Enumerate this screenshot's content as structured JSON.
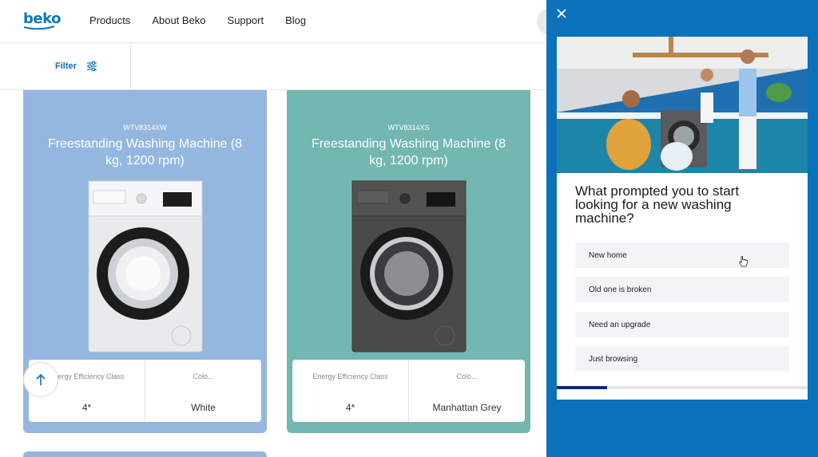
{
  "header": {
    "logo": "beko",
    "nav": [
      "Products",
      "About Beko",
      "Support",
      "Blog"
    ]
  },
  "filter": {
    "label": "Filter"
  },
  "products": [
    {
      "sku": "WTV8314XW",
      "title": "Freestanding Washing Machine (8 kg, 1200 rpm)",
      "specs": [
        {
          "label": "Energy Efficiency Class",
          "value": "4*"
        },
        {
          "label": "Colo...",
          "value": "White"
        }
      ]
    },
    {
      "sku": "WTV8314XS",
      "title": "Freestanding Washing Machine (8 kg, 1200 rpm)",
      "specs": [
        {
          "label": "Energy Efficiency Class",
          "value": "4*"
        },
        {
          "label": "Colo...",
          "value": "Manhattan Grey"
        }
      ]
    }
  ],
  "quiz": {
    "question": "What prompted you to start looking for a new washing machine?",
    "options": [
      "New home",
      "Old one is broken",
      "Need an upgrade",
      "Just browsing"
    ],
    "progress": 0.2
  },
  "colors": {
    "brand": "#0b71bb",
    "card_blue": "#94b7df",
    "card_teal": "#72b7b1",
    "progress": "#0b2c6b"
  },
  "icons": [
    "close-icon",
    "filter-sliders-icon",
    "arrow-up-icon",
    "pointer-cursor-icon"
  ]
}
